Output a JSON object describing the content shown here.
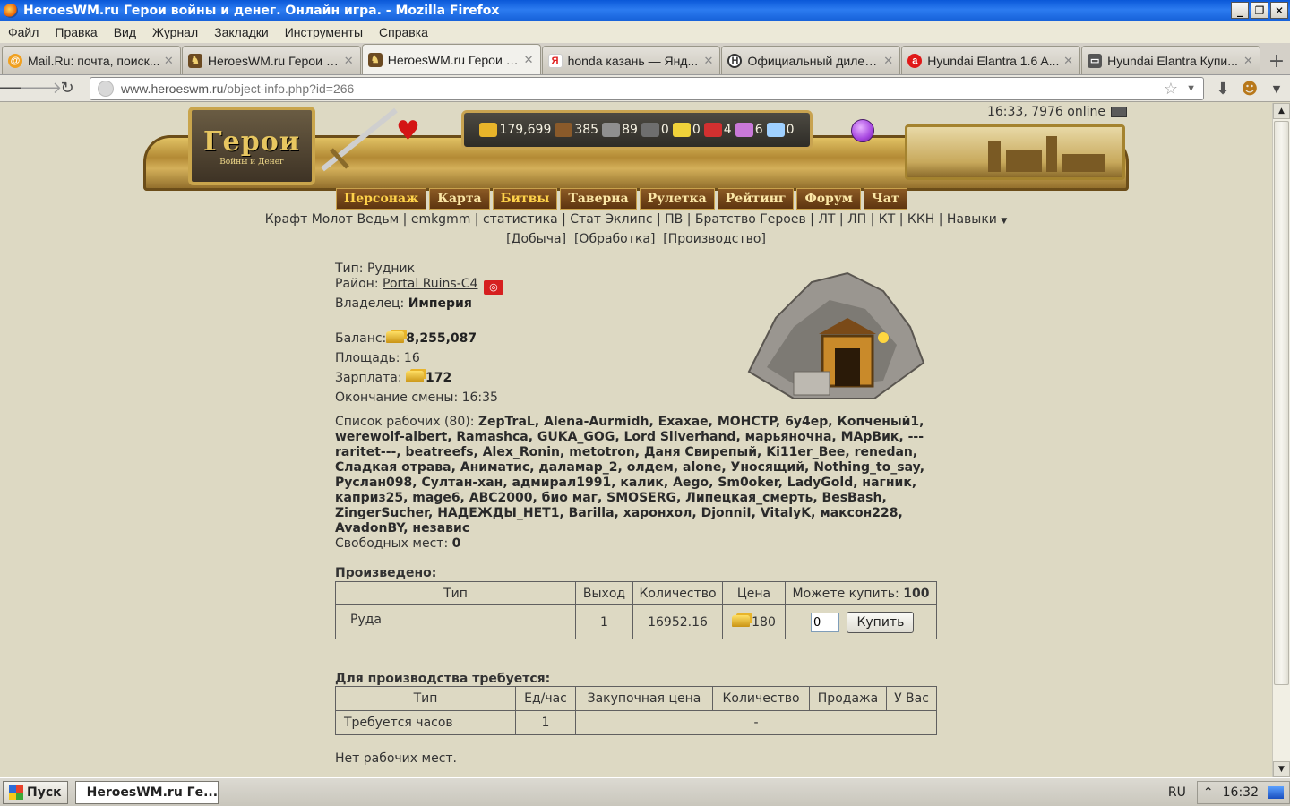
{
  "window": {
    "title": "HeroesWM.ru Герои войны и денег. Онлайн игра. - Mozilla Firefox"
  },
  "menu": [
    "Файл",
    "Правка",
    "Вид",
    "Журнал",
    "Закладки",
    "Инструменты",
    "Справка"
  ],
  "tabs": [
    {
      "label": "Mail.Ru: почта, поиск...",
      "icon": "mailru-icon",
      "active": false
    },
    {
      "label": "HeroesWM.ru Герои в...",
      "icon": "heroes-icon",
      "active": false
    },
    {
      "label": "HeroesWM.ru Герои в...",
      "icon": "heroes-icon",
      "active": true
    },
    {
      "label": "honda казань — Янд...",
      "icon": "yandex-icon",
      "active": false
    },
    {
      "label": "Официальный дилер...",
      "icon": "hyundai-icon",
      "active": false
    },
    {
      "label": "Hyundai Elantra 1.6 A...",
      "icon": "autoru-icon",
      "active": false
    },
    {
      "label": "Hyundai Elantra Купи...",
      "icon": "car-icon",
      "active": false
    }
  ],
  "address": {
    "host": "www.heroeswm.ru",
    "path": "/object-info.php?id=266"
  },
  "header": {
    "logo_title": "Герои",
    "logo_sub": "Войны и Денег",
    "clock": "16:33, 7976 online",
    "resources": [
      {
        "icon": "gold-icon",
        "value": "179,699",
        "color": "#e8b42a"
      },
      {
        "icon": "wood-icon",
        "value": "385",
        "color": "#8a5a2a"
      },
      {
        "icon": "ore-icon",
        "value": "89",
        "color": "#8f8f8f"
      },
      {
        "icon": "mercury-icon",
        "value": "0",
        "color": "#6e6e6e"
      },
      {
        "icon": "sulfur-icon",
        "value": "0",
        "color": "#f0d23a"
      },
      {
        "icon": "crystal-icon",
        "value": "4",
        "color": "#d23030"
      },
      {
        "icon": "gems-icon",
        "value": "6",
        "color": "#c978d8"
      },
      {
        "icon": "diamond-icon",
        "value": "0",
        "color": "#9fd0ff"
      }
    ],
    "main_menu": [
      "Персонаж",
      "Карта",
      "Битвы",
      "Таверна",
      "Рулетка",
      "Рейтинг",
      "Форум",
      "Чат"
    ],
    "sub_links": [
      "Крафт Молот Ведьм",
      "emkgmm",
      "статистика",
      "Стат Эклипс",
      "ПВ",
      "Братство Героев",
      "ЛТ",
      "ЛП",
      "КТ",
      "ККН",
      "Навыки"
    ],
    "sub_tabs": [
      "Добыча",
      "Обработка",
      "Производство"
    ]
  },
  "object": {
    "type_label": "Тип:",
    "type_value": "Рудник",
    "district_label": "Район:",
    "district_value": "Portal Ruins-C4",
    "owner_label": "Владелец:",
    "owner_value": "Империя",
    "balance_label": "Баланс:",
    "balance_value": "8,255,087",
    "area_label": "Площадь:",
    "area_value": "16",
    "salary_label": "Зарплата:",
    "salary_value": "172",
    "shift_end_label": "Окончание смены:",
    "shift_end_value": "16:35",
    "workers_label": "Список рабочих (80):",
    "workers": "ZepTraL, Alena-Aurmidh, Exaxae, MOHCTP, 6y4ep, Копченый1, werewolf-albert, Ramashca, GUKA_GOG, Lord Silverhand, марьяночна, MApВик, ---raritet---, beatreefs, Alex_Ronin, metotron, Даня Свирепый, Ki11er_Bee, renedan, Сладкая отрава, Аниматис, даламар_2, олдем, alone, Уносящий, Nothing_to_say, Руслан098, Султан-хан, адмирал1991, калик, Aego, Sm0oker, LadyGold, нагник, каприз25, mage6, ABC2000, био маг, SMOSERG, Липецкая_смерть, BesBash, ZingerSucher, НАДЕЖДЫ_НЕТ1, Barilla, харонхол, DjonniI, VitalyK, максон228, AvadonBY, независ",
    "free_label": "Свободных мест:",
    "free_value": "0"
  },
  "produced": {
    "title": "Произведено:",
    "headers": [
      "Тип",
      "Выход",
      "Количество",
      "Цена"
    ],
    "can_buy_label": "Можете купить:",
    "can_buy_value": "100",
    "row": {
      "type": "Руда",
      "output": "1",
      "quantity": "16952.16",
      "price": "180",
      "input_value": "0",
      "buy_label": "Купить"
    }
  },
  "required": {
    "title": "Для производства требуется:",
    "headers": [
      "Тип",
      "Ед/час",
      "Закупочная цена",
      "Количество",
      "Продажа",
      "У Вас"
    ],
    "row": {
      "type": "Требуется часов",
      "per_hour": "1",
      "rest": "-"
    }
  },
  "no_jobs": "Нет рабочих мест.",
  "taskbar": {
    "start": "Пуск",
    "task": "HeroesWM.ru Ге...",
    "lang": "RU",
    "time": "16:32"
  }
}
